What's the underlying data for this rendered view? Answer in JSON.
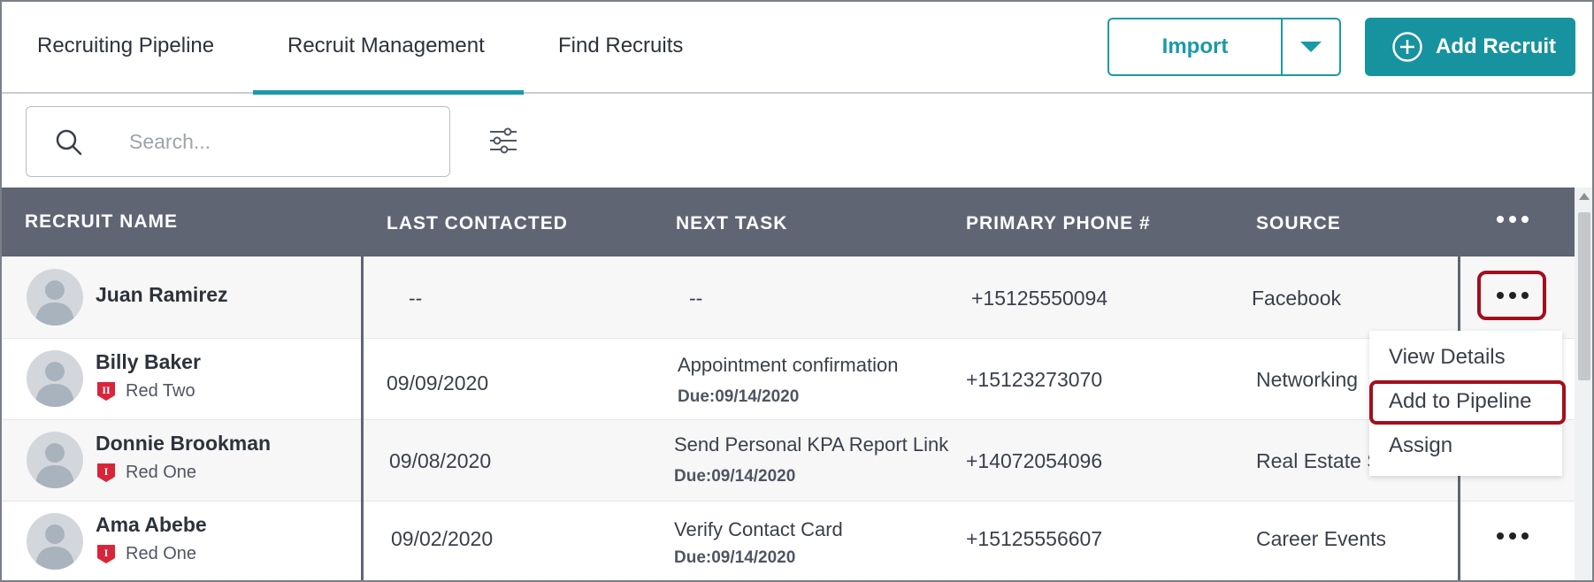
{
  "nav": {
    "tabs": [
      {
        "label": "Recruiting Pipeline"
      },
      {
        "label": "Recruit Management",
        "active": true
      },
      {
        "label": "Find Recruits"
      }
    ],
    "import_label": "Import",
    "add_recruit_label": "Add Recruit"
  },
  "search": {
    "placeholder": "Search..."
  },
  "table": {
    "headers": [
      "RECRUIT NAME",
      "LAST CONTACTED",
      "NEXT TASK",
      "PRIMARY PHONE #",
      "SOURCE"
    ],
    "rows": [
      {
        "name": "Juan Ramirez",
        "team": "",
        "last_contacted": "--",
        "next_task": "--",
        "due": "",
        "phone": "+15125550094",
        "source": "Facebook"
      },
      {
        "name": "Billy Baker",
        "team": "Red Two",
        "team_badge": "II",
        "last_contacted": "09/09/2020",
        "next_task": "Appointment confirmation",
        "due": "Due:09/14/2020",
        "phone": "+15123273070",
        "source": "Networking"
      },
      {
        "name": "Donnie Brookman",
        "team": "Red One",
        "team_badge": "I",
        "last_contacted": "09/08/2020",
        "next_task": "Send Personal KPA Report Link",
        "due": "Due:09/14/2020",
        "phone": "+14072054096",
        "source": "Real Estate S"
      },
      {
        "name": "Ama Abebe",
        "team": "Red One",
        "team_badge": "I",
        "last_contacted": "09/02/2020",
        "next_task": "Verify Contact Card",
        "due": "Due:09/14/2020",
        "phone": "+15125556607",
        "source": "Career Events"
      }
    ]
  },
  "row_menu": {
    "items": [
      "View Details",
      "Add to Pipeline",
      "Assign"
    ],
    "highlighted": "Add to Pipeline"
  },
  "colors": {
    "accent": "#1a9aa7",
    "header_bg": "#5f6573",
    "highlight": "#a30f1b",
    "badge_red": "#d9253a"
  }
}
